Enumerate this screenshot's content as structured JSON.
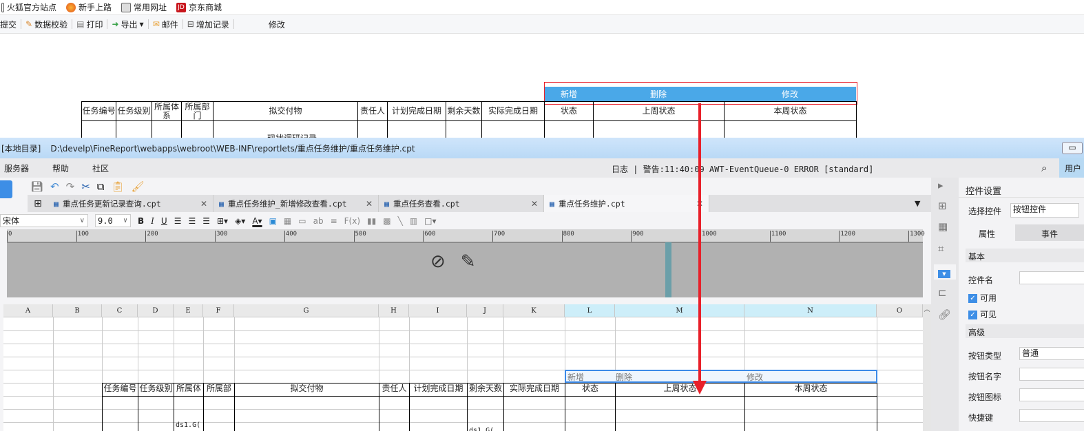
{
  "browser": {
    "bookmarks": [
      "火狐官方站点",
      "新手上路",
      "常用网址",
      "京东商城"
    ]
  },
  "report_toolbar": {
    "items": [
      "提交",
      "数据校验",
      "打印",
      "导出",
      "邮件",
      "增加记录"
    ],
    "edit_label": "修改"
  },
  "preview": {
    "buttons": [
      "新增",
      "删除",
      "修改"
    ],
    "headers": [
      "任务编号",
      "任务级别",
      "所属体系",
      "所属部门",
      "拟交付物",
      "责任人",
      "计划完成日期",
      "剩余天数",
      "实际完成日期",
      "状态",
      "上周状态",
      "本周状态"
    ],
    "partial_text": "现状调研记录"
  },
  "designer": {
    "title_prefix": "[本地目录]",
    "file_path": "D:\\develp\\FineReport\\webapps\\webroot\\WEB-INF\\reportlets/重点任务维护/重点任务维护.cpt",
    "menu": [
      "服务器",
      "帮助",
      "社区"
    ],
    "log": "日志 | 警告:11:40:09 AWT-EventQueue-0 ERROR [standard]",
    "user_label": "用户",
    "tabs": [
      {
        "label": "重点任务更新记录查询.cpt",
        "active": false
      },
      {
        "label": "重点任务维护_新增修改查看.cpt",
        "active": false
      },
      {
        "label": "重点任务查看.cpt",
        "active": false
      },
      {
        "label": "重点任务维护.cpt",
        "active": true
      }
    ],
    "font_name": "宋体",
    "font_size": "9.0",
    "ruler_ticks": [
      "0",
      "100",
      "200",
      "300",
      "400",
      "500",
      "600",
      "700",
      "800",
      "900",
      "1000",
      "1100",
      "1200",
      "1300"
    ],
    "columns": [
      "A",
      "B",
      "C",
      "D",
      "E",
      "F",
      "G",
      "H",
      "I",
      "J",
      "K",
      "L",
      "M",
      "N",
      "O"
    ],
    "selected_columns": [
      "L",
      "M",
      "N"
    ],
    "widget_buttons": [
      "新增",
      "删除",
      "修改"
    ],
    "grid_headers": [
      "任务编号",
      "任务级别",
      "所属体",
      "所属部",
      "拟交付物",
      "责任人",
      "计划完成日期",
      "剩余天数",
      "实际完成日期",
      "状态",
      "上周状态",
      "本周状态"
    ],
    "cell_formulas": [
      "ds1.G(",
      "ds1.G("
    ]
  },
  "panel": {
    "title": "控件设置",
    "select_label": "选择控件",
    "select_value": "按钮控件",
    "tabs": [
      "属性",
      "事件"
    ],
    "basic_section": "基本",
    "name_label": "控件名",
    "enabled_label": "可用",
    "visible_label": "可见",
    "advanced_section": "高级",
    "button_type_label": "按钮类型",
    "button_type_value": "普通",
    "button_name_label": "按钮名字",
    "button_icon_label": "按钮图标",
    "shortcut_label": "快捷键"
  }
}
